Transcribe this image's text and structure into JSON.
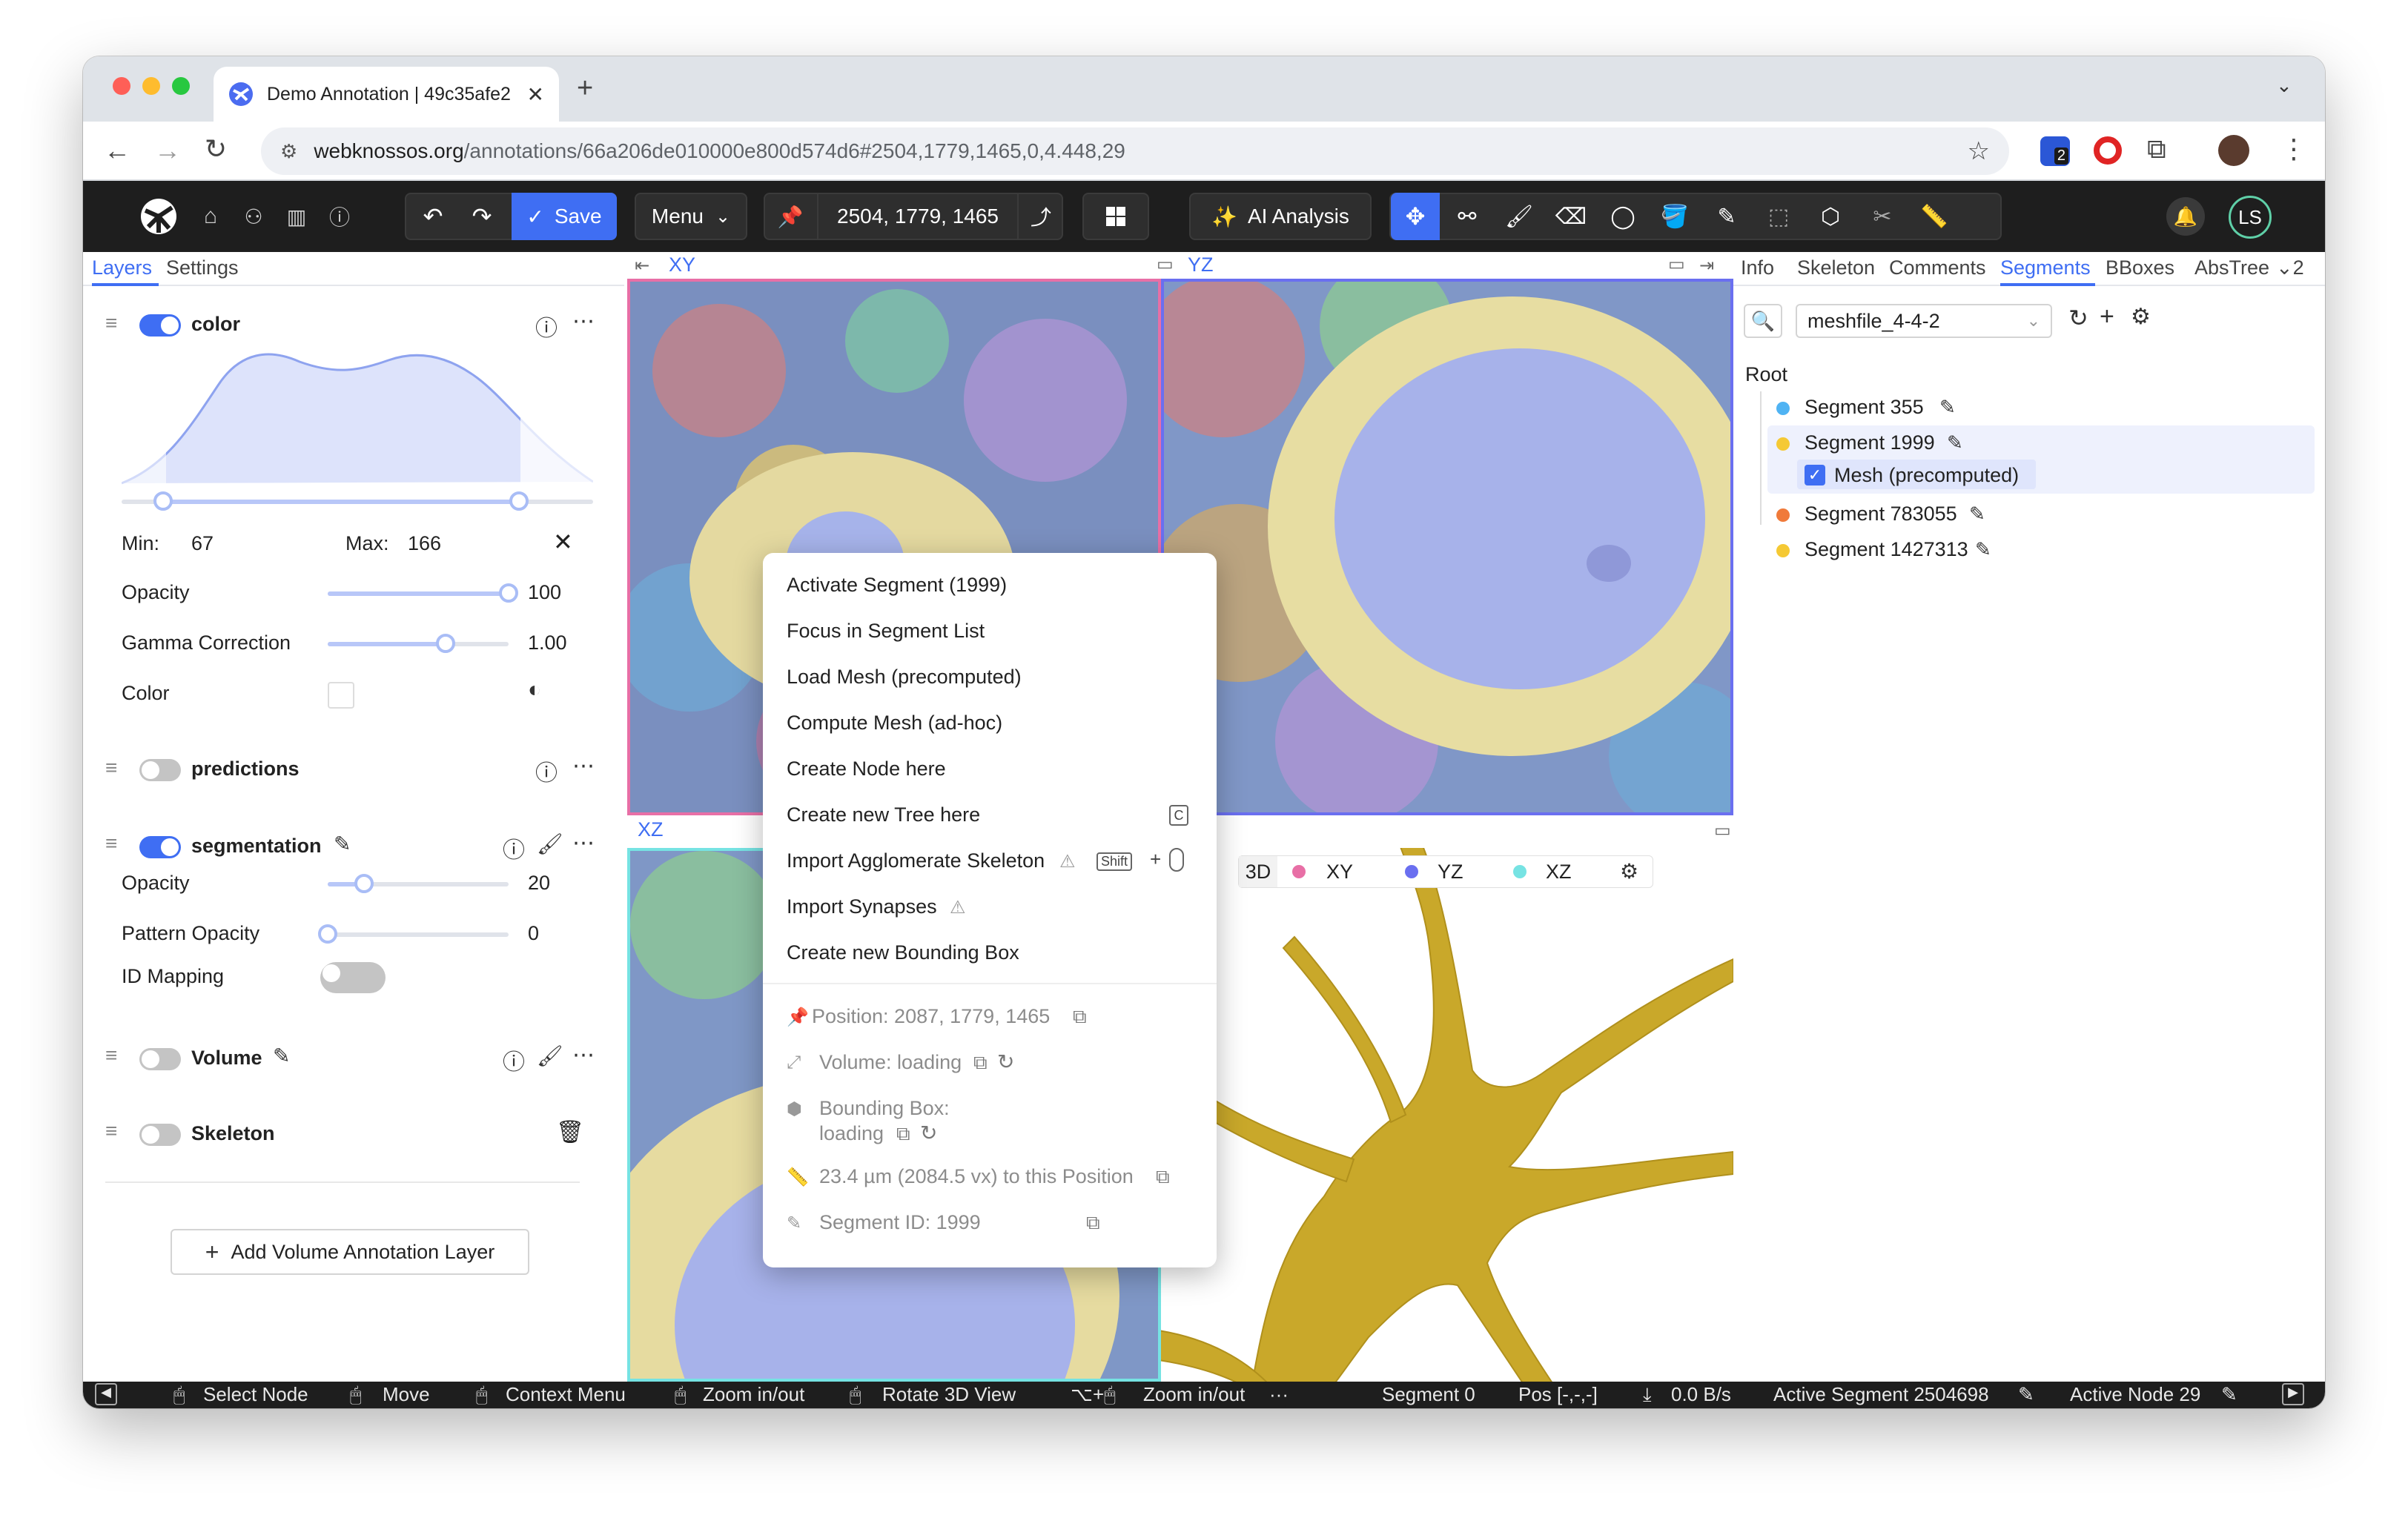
{
  "browser": {
    "tab_title": "Demo Annotation | 49c35afe2",
    "url_host": "webknossos.org",
    "url_path": "/annotations/66a206de010000e800d574d6#2504,1779,1465,0,4.448,29",
    "extension_badge": "2",
    "profile_initials": "LS",
    "icons": [
      "back-icon",
      "forward-icon",
      "reload-icon",
      "site-settings-icon",
      "star-icon",
      "extensions-icon",
      "kebab-icon"
    ]
  },
  "appbar": {
    "save_label": "Save",
    "menu_label": "Menu",
    "position": "2504, 1779, 1465",
    "ai_label": "AI Analysis",
    "avatar": "LS"
  },
  "left": {
    "tabs": [
      "Layers",
      "Settings"
    ],
    "color_layer": {
      "name": "color",
      "min_label": "Min:",
      "min_value": "67",
      "max_label": "Max:",
      "max_value": "166",
      "opacity_label": "Opacity",
      "opacity_value": "100",
      "opacity": 1.0,
      "gamma_label": "Gamma Correction",
      "gamma_value": "1.00",
      "gamma": 0.65,
      "color_label": "Color"
    },
    "predictions_layer": {
      "name": "predictions"
    },
    "segmentation_layer": {
      "name": "segmentation",
      "opacity_label": "Opacity",
      "opacity_value": "20",
      "opacity": 0.2,
      "pattern_label": "Pattern Opacity",
      "pattern_value": "0",
      "pattern": 0.0,
      "mapping_label": "ID Mapping"
    },
    "volume_layer": {
      "name": "Volume"
    },
    "skeleton_layer": {
      "name": "Skeleton"
    },
    "add_layer_button": "Add Volume Annotation Layer"
  },
  "viewports": {
    "xy": "XY",
    "yz": "YZ",
    "xz": "XZ",
    "td_buttons": [
      "3D",
      "XY",
      "YZ",
      "XZ"
    ],
    "td_dot_colors": [
      "#e86fa6",
      "#6a6ff0",
      "#76e3e3"
    ]
  },
  "context_menu": {
    "items": [
      "Activate Segment (1999)",
      "Focus in Segment List",
      "Load Mesh (precomputed)",
      "Compute Mesh (ad-hoc)",
      "Create Node here",
      "Create new Tree here",
      "Import Agglomerate Skeleton",
      "Import Synapses",
      "Create new Bounding Box"
    ],
    "shortcut_c": "C",
    "shortcut_shift": "Shift",
    "info": {
      "position": "Position: 2087, 1779, 1465",
      "volume": "Volume: loading",
      "bbox_label": "Bounding Box:",
      "bbox_value": "loading",
      "distance": "23.4 µm (2084.5 vx) to this Position",
      "segment_id": "Segment ID: 1999"
    }
  },
  "right": {
    "tabs": [
      "Info",
      "Skeleton",
      "Comments",
      "Segments",
      "BBoxes",
      "AbsTree"
    ],
    "overflow_count": "2",
    "mesh_file": "meshfile_4-4-2",
    "root_label": "Root",
    "segments": [
      {
        "name": "Segment 355",
        "color": "#4fb3f3"
      },
      {
        "name": "Segment 1999",
        "color": "#f5c934"
      },
      {
        "name": "Segment 783055",
        "color": "#f07a3a"
      },
      {
        "name": "Segment 1427313",
        "color": "#f5c934"
      }
    ],
    "mesh_label": "Mesh (precomputed)"
  },
  "status": {
    "select_node": "Select Node",
    "move": "Move",
    "context_menu": "Context Menu",
    "zoom": "Zoom in/out",
    "rotate": "Rotate 3D View",
    "zoom2": "Zoom in/out",
    "ellipsis": "···",
    "segment": "Segment 0",
    "pos": "Pos [-,-,-]",
    "speed": "0.0 B/s",
    "active_segment": "Active Segment 2504698",
    "active_node": "Active Node 29"
  },
  "colors": {
    "accent": "#3f6ef3",
    "appbar_bg": "#1e1e1e",
    "save_bg": "#3f6ef3",
    "mesh_yellow": "#c9a82a"
  }
}
